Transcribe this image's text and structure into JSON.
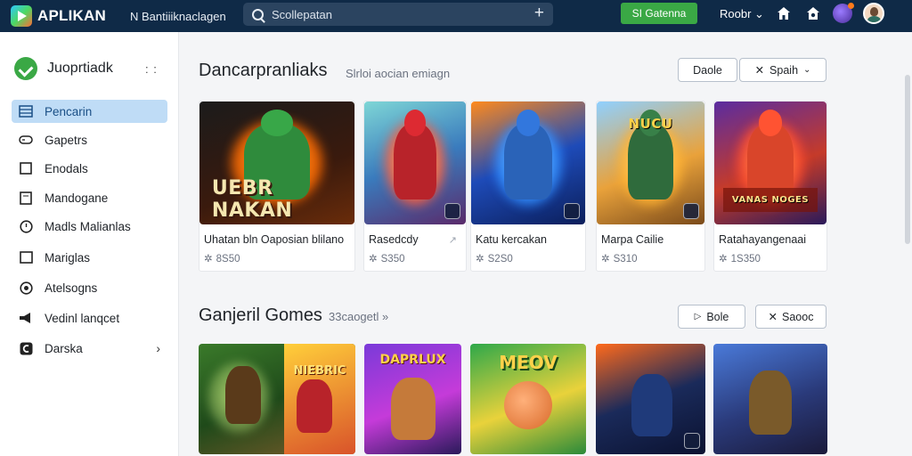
{
  "app": {
    "name": "APLIKAN",
    "breadcrumb": "N Bantiiiknaclagen",
    "search_placeholder": "Scollepatan",
    "install_label": "SI Gatenna",
    "user_menu_label": "Roobr ⌄"
  },
  "sidebar": {
    "brand": "Juoprtiadk",
    "items": [
      {
        "label": "Pencarin",
        "icon": "library-icon",
        "active": true
      },
      {
        "label": "Gapetrs",
        "icon": "gamepad-icon"
      },
      {
        "label": "Enodals",
        "icon": "box-icon"
      },
      {
        "label": "Mandogane",
        "icon": "document-icon"
      },
      {
        "label": "Madls Malianlas",
        "icon": "clock-icon"
      },
      {
        "label": "Mariglas",
        "icon": "square-icon"
      },
      {
        "label": "Atelsogns",
        "icon": "compass-icon"
      },
      {
        "label": "Vedinl lanqcet",
        "icon": "megaphone-icon"
      },
      {
        "label": "Darska",
        "icon": "c-icon",
        "chevron": true
      }
    ]
  },
  "section1": {
    "title": "Dancarpranliaks",
    "subtitle": "Slrloi aocian emiagn",
    "btn_primary": "Daole",
    "btn_secondary": "Spaih",
    "cards": [
      {
        "title": "Uhatan bln Oaposian blilano",
        "meta": "8S50",
        "banner": "UEBR NAKAN",
        "theme": "green-dark"
      },
      {
        "title": "Rasedcdy",
        "meta": "S350",
        "banner": "",
        "theme": "red-teal"
      },
      {
        "title": "Katu kercakan",
        "meta": "S2S0",
        "banner": "",
        "theme": "blue-fire"
      },
      {
        "title": "Marpa Cailie",
        "meta": "S310",
        "banner": "NUCU",
        "theme": "gold-warrior"
      },
      {
        "title": "Ratahayangenaai",
        "meta": "1S350",
        "banner": "VANAS NOGES",
        "theme": "purple-fire"
      }
    ]
  },
  "section2": {
    "title": "Ganjeril Gomes",
    "subtitle": "33caogetl »",
    "btn_primary": "Bole",
    "btn_secondary": "Saooc",
    "cards": [
      {
        "banner": "NIEBRIC",
        "theme": "forest"
      },
      {
        "banner": "DAPRLUX",
        "theme": "violet"
      },
      {
        "banner": "MEOV",
        "theme": "green-yellow"
      },
      {
        "banner": "",
        "theme": "dark-blue"
      },
      {
        "banner": "",
        "theme": "storm"
      }
    ]
  },
  "colors": {
    "topbar": "#0f2a47",
    "accent_green": "#3aa845",
    "active_nav": "#bfdcf6"
  }
}
